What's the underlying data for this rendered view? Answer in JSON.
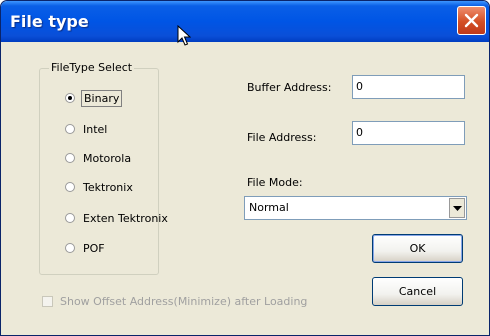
{
  "window": {
    "title": "File type",
    "close_icon": "close-icon",
    "title_color": "#0055e5"
  },
  "filetype_group": {
    "title": "FileType Select",
    "options": [
      {
        "label": "Binary",
        "selected": true
      },
      {
        "label": "Intel",
        "selected": false
      },
      {
        "label": "Motorola",
        "selected": false
      },
      {
        "label": "Tektronix",
        "selected": false
      },
      {
        "label": "Exten Tektronix",
        "selected": false
      },
      {
        "label": "POF",
        "selected": false
      }
    ]
  },
  "buffer_address": {
    "label": "Buffer Address:",
    "value": "0"
  },
  "file_address": {
    "label": "File Address:",
    "value": "0"
  },
  "file_mode": {
    "label": "File Mode:",
    "selected": "Normal"
  },
  "buttons": {
    "ok": "OK",
    "cancel": "Cancel"
  },
  "show_offset": {
    "label": "Show Offset Address(Minimize) after Loading",
    "checked": false,
    "enabled": false
  }
}
